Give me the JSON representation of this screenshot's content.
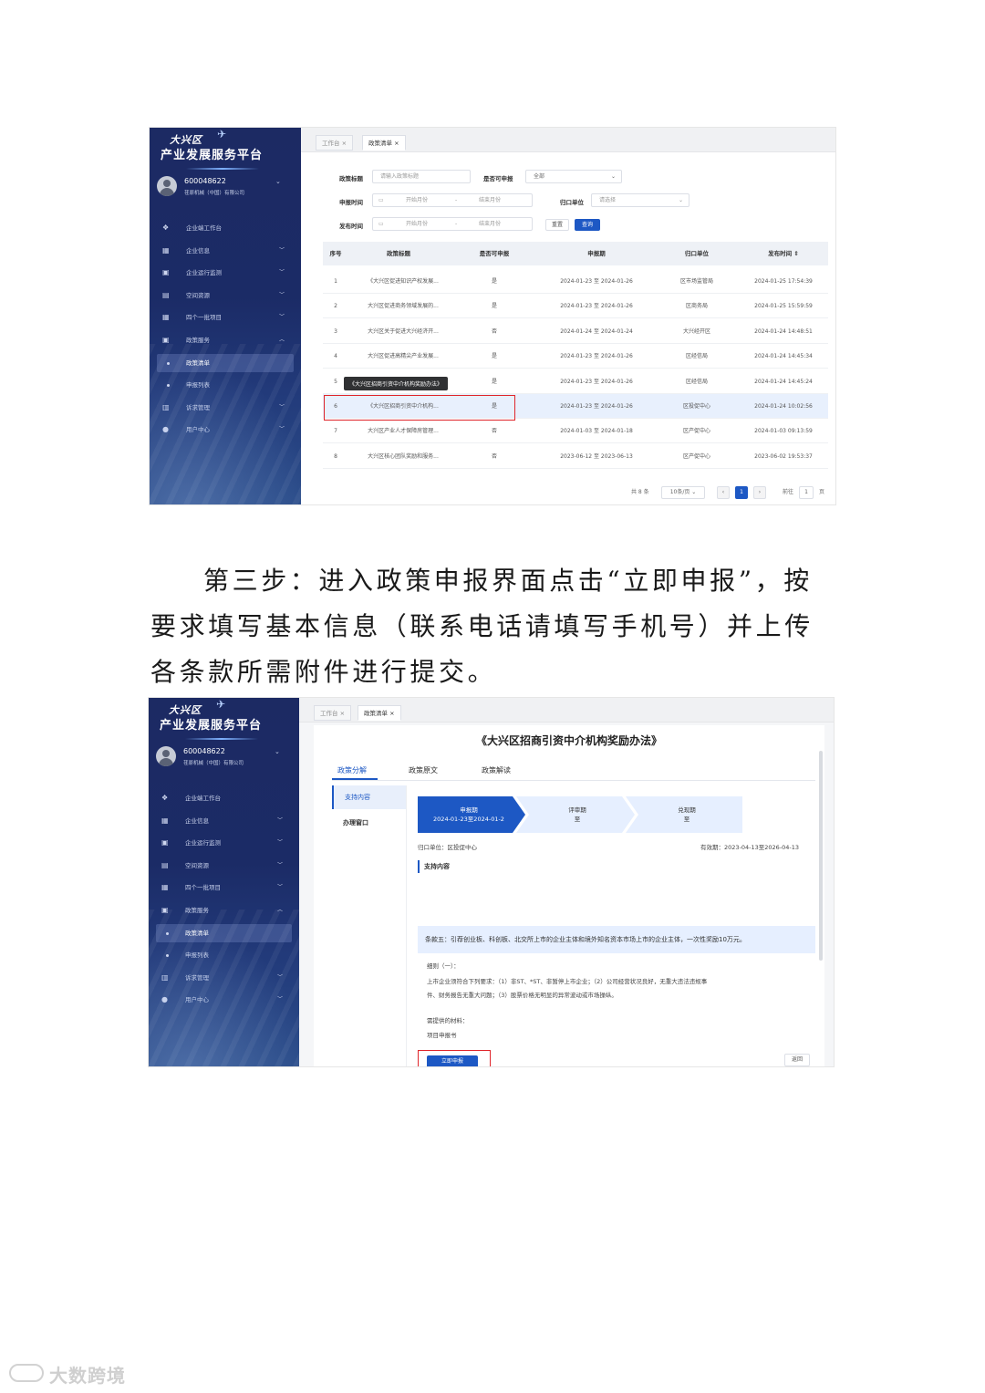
{
  "platform": {
    "title_line1": "大兴区",
    "title_line2": "产业发展服务平台"
  },
  "user": {
    "id": "600048622",
    "company": "荏原机械（中国）有限公司"
  },
  "sidebar": {
    "items": [
      {
        "label": "企业端工作台",
        "icon": "layers-icon"
      },
      {
        "label": "企业信息",
        "icon": "grid-icon"
      },
      {
        "label": "企业运行监测",
        "icon": "monitor-icon"
      },
      {
        "label": "空间资源",
        "icon": "building-icon"
      },
      {
        "label": "四个一批项目",
        "icon": "grid-icon"
      },
      {
        "label": "政策服务",
        "icon": "document-icon"
      },
      {
        "label": "政策清单",
        "sub": true,
        "active": true
      },
      {
        "label": "申报列表",
        "sub": true
      },
      {
        "label": "诉求管理",
        "icon": "chart-icon"
      },
      {
        "label": "用户中心",
        "icon": "user-icon"
      }
    ]
  },
  "tabs": {
    "workbench": "工作台",
    "policy_list": "政策清单"
  },
  "filters": {
    "policy_title_label": "政策标题",
    "policy_title_placeholder": "请输入政策标题",
    "can_apply_label": "是否可申报",
    "can_apply_value": "全部",
    "apply_time_label": "申报时间",
    "start_month": "开始月份",
    "end_month": "结束月份",
    "dash": "-",
    "dept_label": "归口单位",
    "dept_placeholder": "请选择",
    "publish_time_label": "发布时间",
    "reset": "重置",
    "search": "查询"
  },
  "table": {
    "headers": [
      "序号",
      "政策标题",
      "是否可申报",
      "申报期",
      "归口单位",
      "发布时间"
    ],
    "rows": [
      [
        "1",
        "《大兴区促进知识产权发展...",
        "是",
        "2024-01-23 至 2024-01-26",
        "区市场监管局",
        "2024-01-25 17:54:39"
      ],
      [
        "2",
        "大兴区促进商务领域发展的...",
        "是",
        "2024-01-23 至 2024-01-26",
        "区商务局",
        "2024-01-25 15:59:59"
      ],
      [
        "3",
        "大兴区关于促进大兴经济开...",
        "否",
        "2024-01-24 至 2024-01-24",
        "大兴经开区",
        "2024-01-24 14:48:51"
      ],
      [
        "4",
        "大兴区促进高精尖产业发展...",
        "是",
        "2024-01-23 至 2024-01-26",
        "区经信局",
        "2024-01-24 14:45:34"
      ],
      [
        "5",
        "大兴区促进...",
        "是",
        "2024-01-23 至 2024-01-26",
        "区经信局",
        "2024-01-24 14:45:24"
      ],
      [
        "6",
        "《大兴区招商引资中介机构...",
        "是",
        "2024-01-23 至 2024-01-26",
        "区投促中心",
        "2024-01-24 10:02:56"
      ],
      [
        "7",
        "大兴区产业人才保障房管理...",
        "否",
        "2024-01-03 至 2024-01-18",
        "区产促中心",
        "2024-01-03 09:13:59"
      ],
      [
        "8",
        "大兴区核心团队奖励和服务...",
        "否",
        "2023-06-12 至 2023-06-13",
        "区产促中心",
        "2023-06-02 19:53:37"
      ]
    ],
    "tooltip": "《大兴区招商引资中介机构奖励办法》"
  },
  "pagination": {
    "total": "共 8 条",
    "page_size": "10条/页",
    "prev": "‹",
    "current": "1",
    "next": "›",
    "goto": "前往",
    "goto_value": "1",
    "page_unit": "页"
  },
  "paragraph": {
    "text": "第三步：进入政策申报界面点击“立即申报”，按要求填写基本信息（联系电话请填写手机号）并上传各条款所需附件进行提交。"
  },
  "detail": {
    "title": "《大兴区招商引资中介机构奖励办法》",
    "tabs": [
      "政策分解",
      "政策原文",
      "政策解读"
    ],
    "left_nav": [
      "支持内容",
      "办理窗口"
    ],
    "steps": [
      {
        "name": "申报期",
        "value": "2024-01-23至2024-01-2"
      },
      {
        "name": "评审期",
        "value": "至"
      },
      {
        "name": "兑现期",
        "value": "至"
      }
    ],
    "dept": "归口单位：区投促中心",
    "validity": "有效期：2023-04-13至2026-04-13",
    "section_title": "支持内容",
    "clause": "条款五：引荐创业板、科创板、北交所上市的企业主体和境外知名资本市场上市的企业主体，一次性奖励10万元。",
    "rule_title": "细则（一）：",
    "rule_text_1": "上市企业须符合下列要求：（1）非ST、*ST、非暂停上市企业；（2）公司经营状况良好，无重大违法违规事",
    "rule_text_2": "件、财务报告无重大问题；（3）股票价格无明显的异常波动或市场操纵。",
    "materials_label": "需提供的材料：",
    "materials_item": "项目申报书",
    "apply_button": "立即申报",
    "back_button": "返回"
  },
  "watermark": "大数跨境",
  "colors": {
    "primary": "#1d58c4",
    "sidebar": "#1c2a63",
    "highlight_box": "#e0262c"
  }
}
